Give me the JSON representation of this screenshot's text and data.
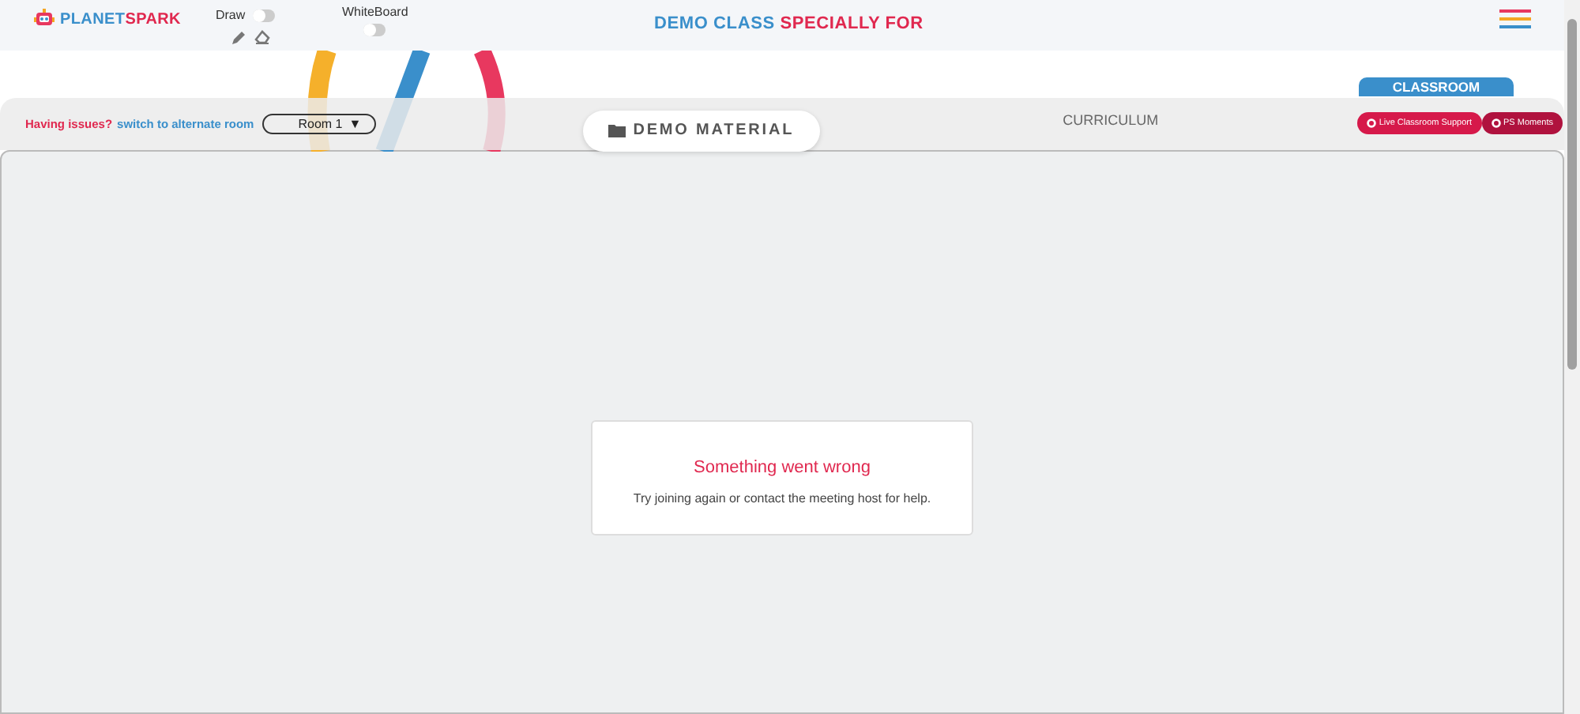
{
  "header": {
    "logo": {
      "part_1": "PLANET",
      "part_2": "SPARK"
    },
    "toggles": [
      {
        "label": "Draw",
        "on": false,
        "kind": "draw"
      },
      {
        "label": "WhiteBoard",
        "on": false,
        "kind": "plain"
      }
    ],
    "title": {
      "part_1": "DEMO CLASS",
      "part_2": "SPECIALLY FOR"
    }
  },
  "toolbar": {
    "issue_text": "Having issues?",
    "switch_link": "switch to alternate room",
    "room_select": {
      "value": "Room 1",
      "arrow": "▼"
    }
  },
  "tabs": [
    {
      "label": "DEMO MATERIAL",
      "selected": true,
      "kind": "pill"
    },
    {
      "label": "CURRICULUM",
      "selected": false,
      "kind": "plain"
    },
    {
      "label": "CLASSROOM",
      "selected": false,
      "kind": "flag"
    }
  ],
  "action_buttons": [
    {
      "label": "Live Classroom Support",
      "color": "#d6194a"
    },
    {
      "label": "PS Moments",
      "color": "#b0123e"
    }
  ],
  "error_card": {
    "title": "Something went wrong",
    "message": "Try joining again or contact the meeting host for help."
  }
}
